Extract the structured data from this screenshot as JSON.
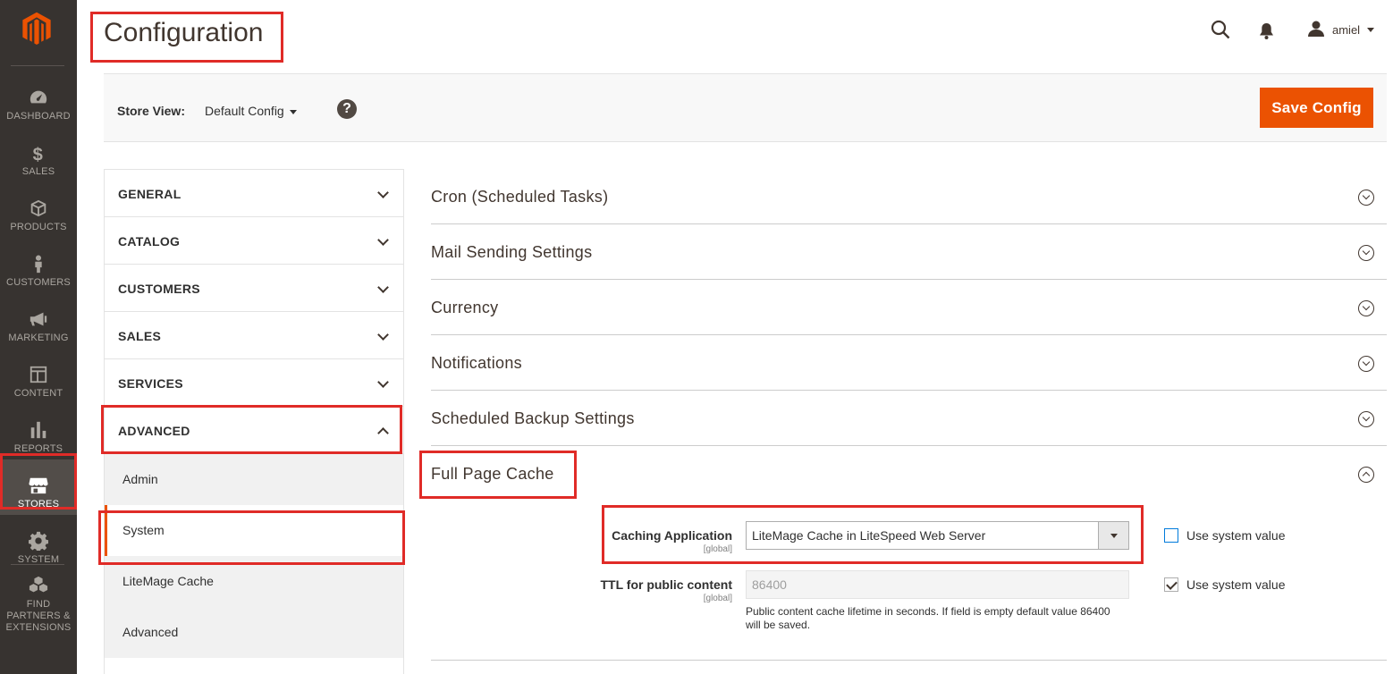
{
  "nav": {
    "items": [
      {
        "id": "dashboard",
        "label": "DASHBOARD",
        "icon": "dashboard-icon"
      },
      {
        "id": "sales",
        "label": "SALES",
        "icon": "dollar-icon"
      },
      {
        "id": "products",
        "label": "PRODUCTS",
        "icon": "box-icon"
      },
      {
        "id": "customers",
        "label": "CUSTOMERS",
        "icon": "person-icon"
      },
      {
        "id": "marketing",
        "label": "MARKETING",
        "icon": "megaphone-icon"
      },
      {
        "id": "content",
        "label": "CONTENT",
        "icon": "layout-icon"
      },
      {
        "id": "reports",
        "label": "REPORTS",
        "icon": "bar-chart-icon"
      },
      {
        "id": "stores",
        "label": "STORES",
        "icon": "storefront-icon",
        "active": true
      },
      {
        "id": "system",
        "label": "SYSTEM",
        "icon": "gear-icon"
      },
      {
        "id": "partners",
        "label": "FIND PARTNERS & EXTENSIONS",
        "icon": "cubes-icon"
      }
    ]
  },
  "header": {
    "title": "Configuration",
    "user": "amiel"
  },
  "store_bar": {
    "label": "Store View:",
    "value": "Default Config",
    "help": "?",
    "save_label": "Save Config"
  },
  "config_nav": {
    "tabs": [
      "GENERAL",
      "CATALOG",
      "CUSTOMERS",
      "SALES",
      "SERVICES",
      "ADVANCED"
    ],
    "advanced_items": [
      "Admin",
      "System",
      "LiteMage Cache",
      "Advanced"
    ]
  },
  "sections": [
    "Cron (Scheduled Tasks)",
    "Mail Sending Settings",
    "Currency",
    "Notifications",
    "Scheduled Backup Settings",
    "Full Page Cache"
  ],
  "fpc": {
    "caching_label": "Caching Application",
    "caching_scope": "[global]",
    "caching_value": "LiteMage Cache in LiteSpeed Web Server",
    "caching_use_system": "Use system value",
    "ttl_label": "TTL for public content",
    "ttl_scope": "[global]",
    "ttl_value": "86400",
    "ttl_note_1": "Public content cache lifetime in seconds. If field is empty default value 86400",
    "ttl_note_2": "will be saved.",
    "ttl_use_system": "Use system value"
  },
  "colors": {
    "nav_bg": "#373330",
    "accent": "#eb5202",
    "highlight_box": "#e02b27"
  }
}
